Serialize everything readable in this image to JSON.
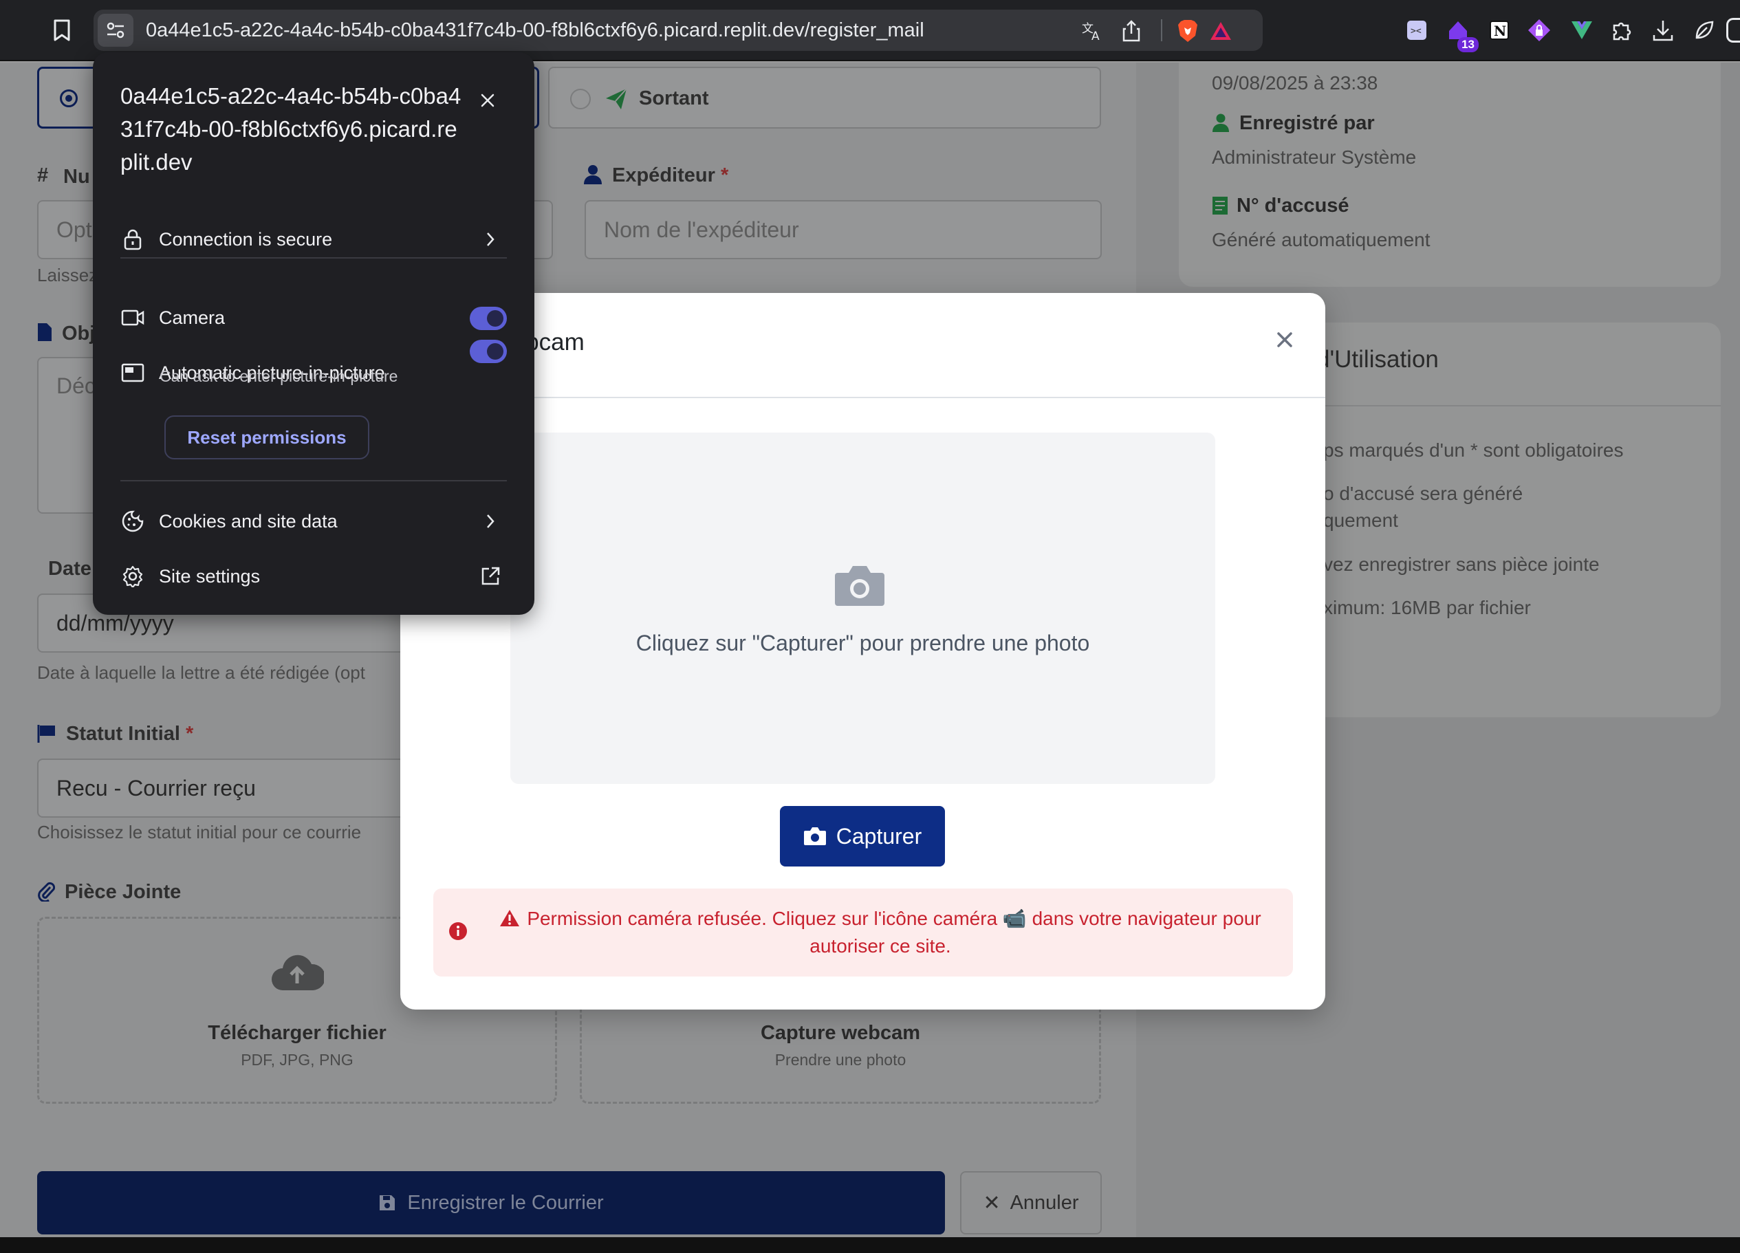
{
  "browser": {
    "url": "0a44e1c5-a22c-4a4c-b54b-c0ba431f7c4b-00-f8bl6ctxf6y6.picard.replit.dev/register_mail",
    "extension_badge": "13"
  },
  "site_info": {
    "host": "0a44e1c5-a22c-4a4c-b54b-c0ba431f7c4b-00-f8bl6ctxf6y6.picard.replit.dev",
    "connection": "Connection is secure",
    "camera_label": "Camera",
    "camera_enabled": true,
    "pip_label": "Automatic picture-in-picture",
    "pip_sub": "Can ask to enter picture-in-picture",
    "pip_enabled": true,
    "reset_label": "Reset permissions",
    "cookies_label": "Cookies and site data",
    "settings_label": "Site settings"
  },
  "form": {
    "direction_outgoing": "Sortant",
    "number_label_partial": "Nu",
    "number_placeholder_partial": "Opt",
    "number_help_partial": "Laissez",
    "sender_label": "Expéditeur",
    "required_mark": "*",
    "sender_placeholder": "Nom de l'expéditeur",
    "object_label_partial": "Obj",
    "object_placeholder_partial": "Déc",
    "date_label_partial": "Date",
    "date_placeholder": "dd/mm/yyyy",
    "date_help": "Date à laquelle la lettre a été rédigée (opt",
    "status_label": "Statut Initial",
    "status_value": "Recu - Courrier reçu",
    "status_help": "Choisissez le statut initial pour ce courrie",
    "attachment_label": "Pièce Jointe",
    "upload_title": "Télécharger fichier",
    "upload_sub": "PDF, JPG, PNG",
    "webcam_title": "Capture webcam",
    "webcam_sub": "Prendre une photo",
    "submit_label": "Enregistrer le Courrier",
    "cancel_label": "Annuler"
  },
  "sidebar": {
    "date_value": "09/08/2025 à 23:38",
    "recorded_by_label": "Enregistré par",
    "recorded_by_value": "Administrateur Système",
    "receipt_label": "N° d'accusé",
    "receipt_value": "Généré automatiquement",
    "guide_title_partial": "d'Utilisation",
    "guide_items": [
      "ps marqués d'un * sont obligatoires",
      "o d'accusé sera généré",
      "quement",
      "vez enregistrer sans pièce jointe",
      "ximum: 16MB par fichier"
    ]
  },
  "modal": {
    "title_partial": "ure Webcam",
    "hint": "Cliquez sur \"Capturer\" pour prendre une photo",
    "capture_label": "Capturer",
    "error_message": "Permission caméra refusée. Cliquez sur l'icône caméra 📹 dans votre navigateur pour autoriser ce site."
  },
  "colors": {
    "primary": "#0d2d86",
    "error": "#c8222f",
    "toggle": "#5c5fd6",
    "green": "#1f8a3a"
  }
}
